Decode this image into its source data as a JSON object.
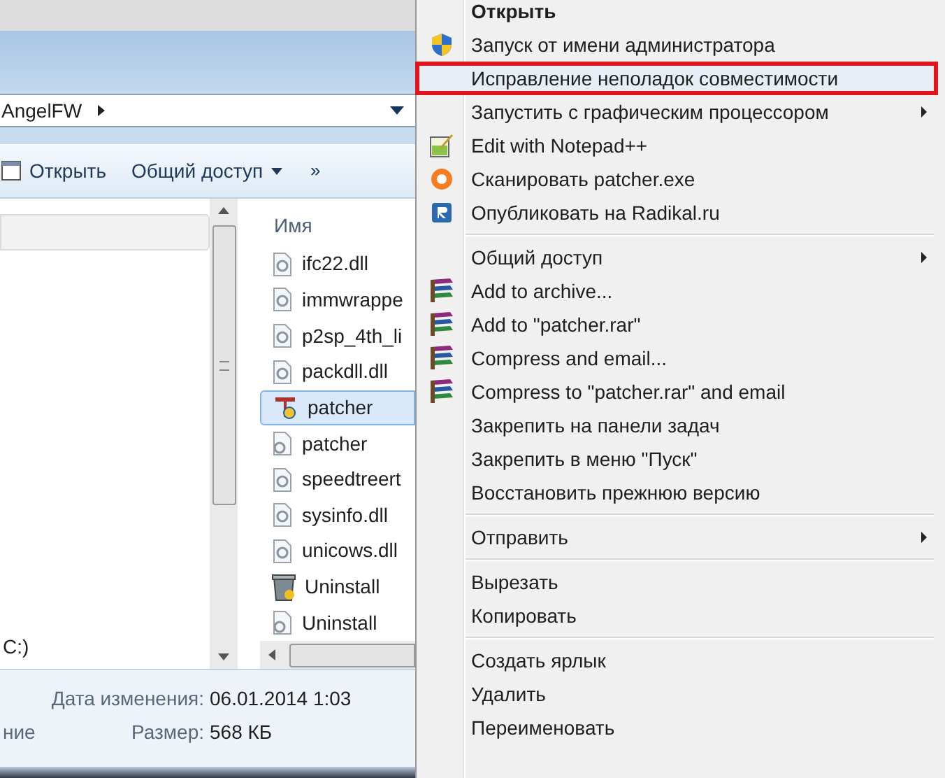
{
  "explorer": {
    "address": "AngelFW",
    "toolbar": [
      {
        "label": "Открыть",
        "kind": "open"
      },
      {
        "label": "Общий доступ",
        "kind": "dropdown"
      },
      {
        "label": "»",
        "kind": "more"
      }
    ],
    "nav_items": [
      "C:)"
    ],
    "column_header": "Имя",
    "files": [
      {
        "name": "ifc22.dll",
        "kind": "dll",
        "selected": false
      },
      {
        "name": "immwrappe",
        "kind": "dll",
        "selected": false
      },
      {
        "name": "p2sp_4th_li",
        "kind": "dll",
        "selected": false
      },
      {
        "name": "packdll.dll",
        "kind": "dll",
        "selected": false
      },
      {
        "name": "patcher",
        "kind": "app",
        "selected": true
      },
      {
        "name": "patcher",
        "kind": "config",
        "selected": false
      },
      {
        "name": "speedtreert",
        "kind": "dll",
        "selected": false
      },
      {
        "name": "sysinfo.dll",
        "kind": "dll",
        "selected": false
      },
      {
        "name": "unicows.dll",
        "kind": "dll",
        "selected": false
      },
      {
        "name": "Uninstall",
        "kind": "uninstall",
        "selected": false
      },
      {
        "name": "Uninstall",
        "kind": "config",
        "selected": false
      }
    ],
    "details": {
      "cut_label": "ние",
      "fields": [
        {
          "label": "Дата изменения:",
          "value": "06.01.2014 1:03"
        },
        {
          "label": "Размер:",
          "value": "568 КБ"
        }
      ]
    }
  },
  "context_menu": {
    "sections": [
      {
        "items": [
          {
            "label": "Открыть",
            "kind": "none",
            "default": true,
            "submenu": false,
            "highlighted": false
          },
          {
            "label": "Запуск от имени администратора",
            "kind": "shield",
            "default": false,
            "submenu": false,
            "highlighted": false
          },
          {
            "label": "Исправление неполадок совместимости",
            "kind": "none",
            "default": false,
            "submenu": false,
            "highlighted": true
          },
          {
            "label": "Запустить с графическим процессором",
            "kind": "none",
            "default": false,
            "submenu": true,
            "highlighted": false
          },
          {
            "label": "Edit with Notepad++",
            "kind": "notepad",
            "default": false,
            "submenu": false,
            "highlighted": false
          },
          {
            "label": "Сканировать patcher.exe",
            "kind": "antivirus",
            "default": false,
            "submenu": false,
            "highlighted": false
          },
          {
            "label": "Опубликовать на Radikal.ru",
            "kind": "radikal",
            "default": false,
            "submenu": false,
            "highlighted": false
          }
        ]
      },
      {
        "items": [
          {
            "label": "Общий доступ",
            "kind": "none",
            "default": false,
            "submenu": true,
            "highlighted": false
          },
          {
            "label": "Add to archive...",
            "kind": "archive",
            "default": false,
            "submenu": false,
            "highlighted": false
          },
          {
            "label": "Add to \"patcher.rar\"",
            "kind": "archive",
            "default": false,
            "submenu": false,
            "highlighted": false
          },
          {
            "label": "Compress and email...",
            "kind": "archive",
            "default": false,
            "submenu": false,
            "highlighted": false
          },
          {
            "label": "Compress to \"patcher.rar\" and email",
            "kind": "archive",
            "default": false,
            "submenu": false,
            "highlighted": false
          },
          {
            "label": "Закрепить на панели задач",
            "kind": "none",
            "default": false,
            "submenu": false,
            "highlighted": false
          },
          {
            "label": "Закрепить в меню \"Пуск\"",
            "kind": "none",
            "default": false,
            "submenu": false,
            "highlighted": false
          },
          {
            "label": "Восстановить прежнюю версию",
            "kind": "none",
            "default": false,
            "submenu": false,
            "highlighted": false
          }
        ]
      },
      {
        "items": [
          {
            "label": "Отправить",
            "kind": "none",
            "default": false,
            "submenu": true,
            "highlighted": false
          }
        ]
      },
      {
        "items": [
          {
            "label": "Вырезать",
            "kind": "none",
            "default": false,
            "submenu": false,
            "highlighted": false
          },
          {
            "label": "Копировать",
            "kind": "none",
            "default": false,
            "submenu": false,
            "highlighted": false
          }
        ]
      },
      {
        "items": [
          {
            "label": "Создать ярлык",
            "kind": "none",
            "default": false,
            "submenu": false,
            "highlighted": false
          },
          {
            "label": "Удалить",
            "kind": "none",
            "default": false,
            "submenu": false,
            "highlighted": false
          },
          {
            "label": "Переименовать",
            "kind": "none",
            "default": false,
            "submenu": false,
            "highlighted": false
          }
        ]
      }
    ]
  }
}
